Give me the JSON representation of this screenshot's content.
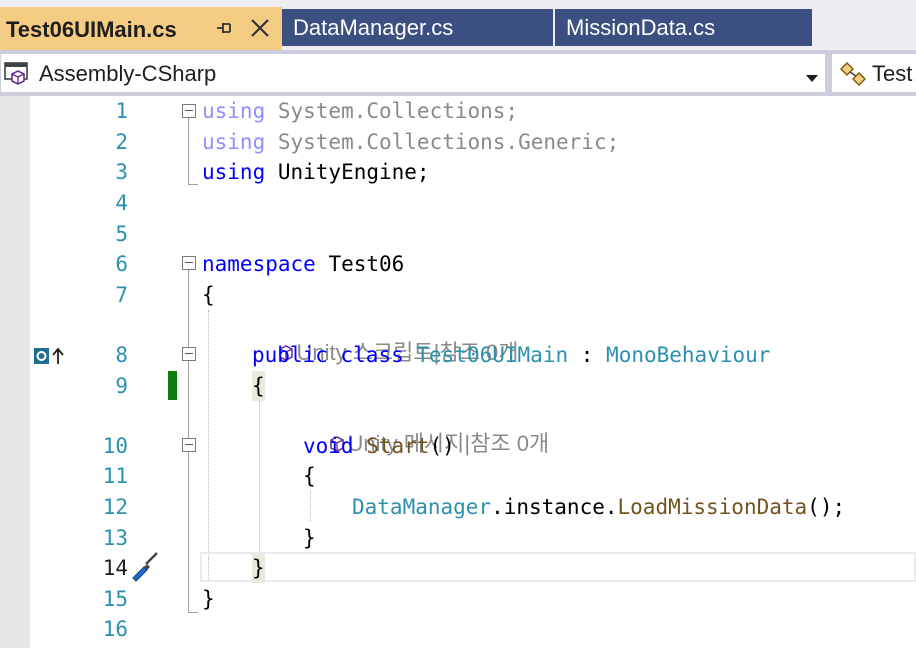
{
  "tabs": [
    {
      "label": "Test06UIMain.cs",
      "active": true
    },
    {
      "label": "DataManager.cs",
      "active": false
    },
    {
      "label": "MissionData.cs",
      "active": false
    }
  ],
  "navbar": {
    "project_label": "Assembly-CSharp",
    "type_label": "Test"
  },
  "line_numbers": [
    "1",
    "2",
    "3",
    "4",
    "5",
    "6",
    "7",
    "8",
    "9",
    "10",
    "11",
    "12",
    "13",
    "14",
    "15",
    "16"
  ],
  "code": {
    "l1": {
      "kw": "using",
      "rest": " System.Collections;"
    },
    "l2": {
      "kw": "using",
      "rest": " System.Collections.Generic;"
    },
    "l3": {
      "kw": "using",
      "rest": " UnityEngine;"
    },
    "l6": {
      "kw": "namespace",
      "rest": " Test06"
    },
    "l7": "{",
    "lens1": "Unity 스크립트|참조 0개",
    "l8": {
      "kw1": "public",
      "kw2": "class",
      "type": "Test06UIMain",
      "sep": " : ",
      "base": "MonoBehaviour"
    },
    "l9": "{",
    "lens2": "Unity 메시지|참조 0개",
    "l10": {
      "kw": "void",
      "method": "Start",
      "rest": "()"
    },
    "l11": "{",
    "l12": {
      "type": "DataManager",
      "mid": ".instance.",
      "method": "LoadMissionData",
      "rest": "();"
    },
    "l13": "}",
    "l14": "}",
    "l15": "}"
  },
  "colors": {
    "active_tab": "#f5cc84",
    "inactive_tab": "#3b4f81",
    "keyword": "#0000ff",
    "type": "#2b91af",
    "method": "#74531f",
    "line_number": "#2b91af",
    "change_bar": "#107c10"
  },
  "icons": {
    "pin": "pin-icon",
    "close": "close-icon",
    "project": "csharp-project-icon",
    "dropdown": "chevron-down-icon",
    "type": "class-icon",
    "unity": "unity-cube-icon",
    "override": "override-marker-icon",
    "quick_action": "screwdriver-icon"
  }
}
